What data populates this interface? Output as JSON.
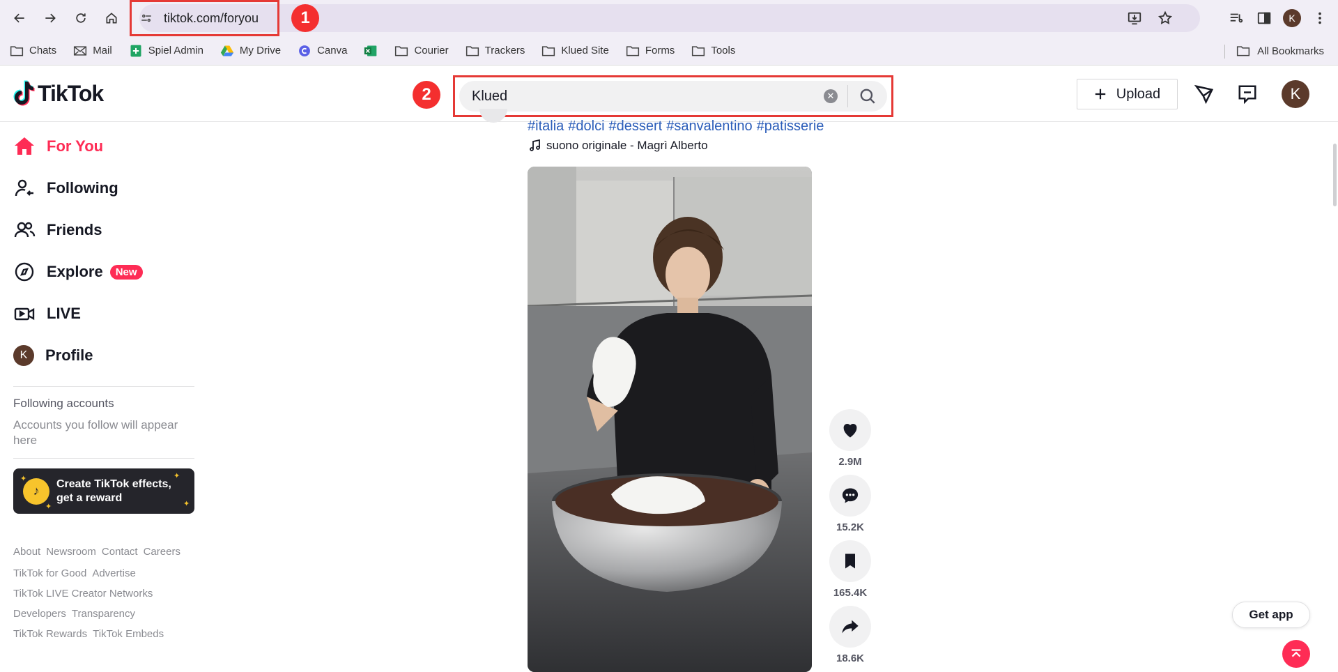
{
  "browser": {
    "url": "tiktok.com/foryou",
    "annotation_1": "1",
    "annotation_2": "2",
    "profile_initial": "K",
    "bookmarks": [
      "Chats",
      "Mail",
      "Spiel Admin",
      "My Drive",
      "Canva",
      "",
      "Courier",
      "Trackers",
      "Klued Site",
      "Forms",
      "Tools"
    ],
    "all_bookmarks": "All Bookmarks"
  },
  "header": {
    "logo_text": "TikTok",
    "search_value": "Klued",
    "upload_label": "Upload",
    "avatar_initial": "K"
  },
  "sidebar": {
    "items": [
      {
        "label": "For You",
        "icon": "home-icon"
      },
      {
        "label": "Following",
        "icon": "following-icon"
      },
      {
        "label": "Friends",
        "icon": "friends-icon"
      },
      {
        "label": "Explore",
        "icon": "compass-icon",
        "badge": "New"
      },
      {
        "label": "LIVE",
        "icon": "live-icon"
      },
      {
        "label": "Profile",
        "icon": "avatar",
        "initial": "K"
      }
    ],
    "following_title": "Following accounts",
    "following_sub": "Accounts you follow will appear here",
    "effects_line1": "Create TikTok effects,",
    "effects_line2": "get a reward",
    "footer": [
      [
        "About",
        "Newsroom",
        "Contact",
        "Careers"
      ],
      [
        "TikTok for Good",
        "Advertise"
      ],
      [
        "TikTok LIVE Creator Networks"
      ],
      [
        "Developers",
        "Transparency"
      ],
      [
        "TikTok Rewards",
        "TikTok Embeds"
      ]
    ]
  },
  "post": {
    "hashtags": [
      "#italia",
      "#dolci",
      "#dessert",
      "#sanvalentino",
      "#patisserie"
    ],
    "music": "suono originale - Magrì Alberto",
    "likes": "2.9M",
    "comments": "15.2K",
    "saves": "165.4K",
    "shares": "18.6K"
  },
  "floating": {
    "get_app": "Get app"
  },
  "colors": {
    "accent": "#fe2c55",
    "hashtag": "#2b5db9",
    "annotation": "#e53935"
  }
}
